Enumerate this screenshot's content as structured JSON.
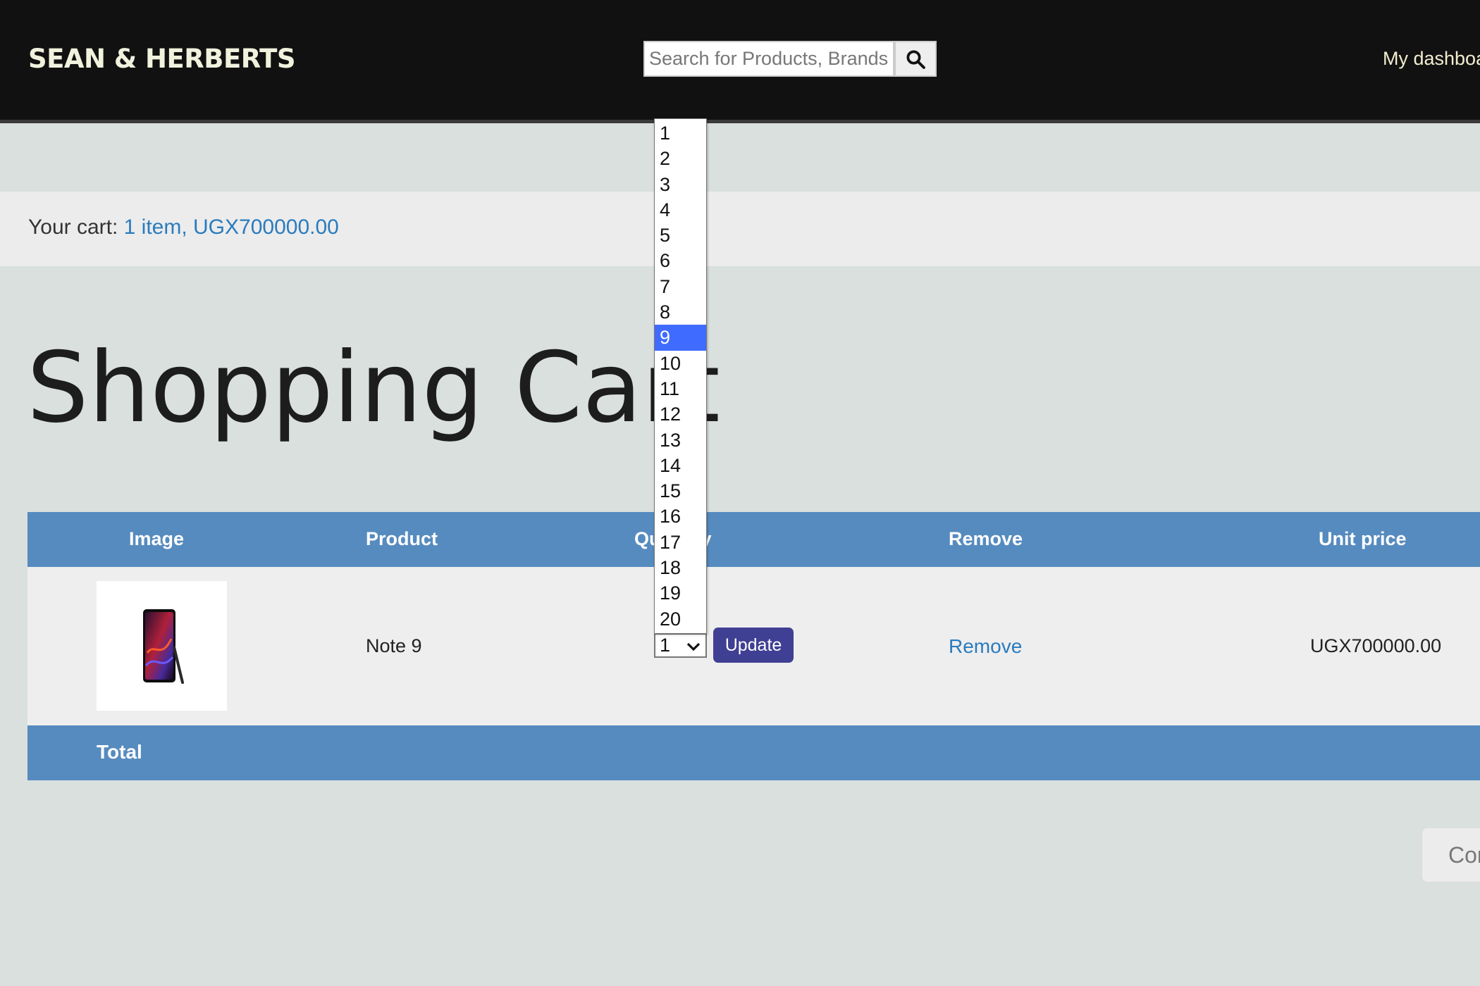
{
  "header": {
    "brand": "SEAN & HERBERTS",
    "search_placeholder": "Search for Products, Brands",
    "dashboard_link": "My dashboard"
  },
  "cart_bar": {
    "label": "Your cart:",
    "summary": "1 item, UGX700000.00"
  },
  "page_title": "Shopping Cart",
  "table": {
    "headers": [
      "Image",
      "Product",
      "Quantity",
      "Remove",
      "Unit price"
    ],
    "rows": [
      {
        "product": "Note 9",
        "quantity": "1",
        "remove": "Remove",
        "unit_price": "UGX700000.00"
      }
    ],
    "update_label": "Update",
    "total_label": "Total"
  },
  "quantity_options": [
    "1",
    "2",
    "3",
    "4",
    "5",
    "6",
    "7",
    "8",
    "9",
    "10",
    "11",
    "12",
    "13",
    "14",
    "15",
    "16",
    "17",
    "18",
    "19",
    "20"
  ],
  "highlighted_option": "9",
  "continue_button": "Continue shopping",
  "colors": {
    "header_bg": "#111111",
    "table_header": "#568bbf",
    "link": "#2a7bbd",
    "update_button": "#3f3f94",
    "option_highlight": "#3f6bff"
  }
}
